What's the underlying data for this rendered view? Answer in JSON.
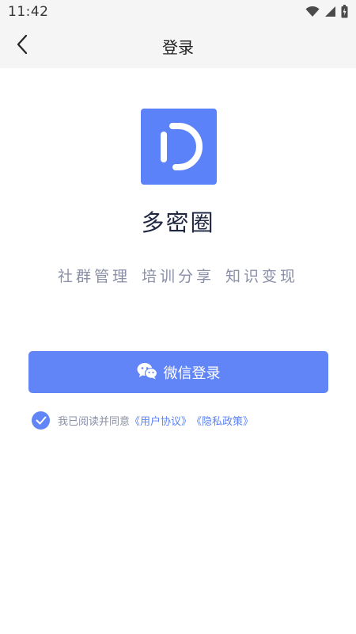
{
  "status_bar": {
    "time": "11:42",
    "icons": [
      "wifi-icon",
      "signal-icon",
      "battery-icon"
    ]
  },
  "nav": {
    "title": "登录",
    "back_icon": "chevron-left-icon"
  },
  "app": {
    "name": "多密圈",
    "slogan": "社群管理 培训分享 知识变现",
    "logo_icon": "app-logo-d-icon"
  },
  "login": {
    "wechat_label": "微信登录",
    "wechat_icon": "wechat-icon"
  },
  "agreement": {
    "checked": true,
    "prefix": "我已阅读并同意",
    "user_agreement": "《用户协议》",
    "privacy_policy": "《隐私政策》"
  },
  "colors": {
    "accent": "#6185f6",
    "logo_bg": "#5b82f8",
    "title_text": "#1f2640",
    "muted_text": "#8a8fa6",
    "bar_bg": "#f5f5f5"
  }
}
